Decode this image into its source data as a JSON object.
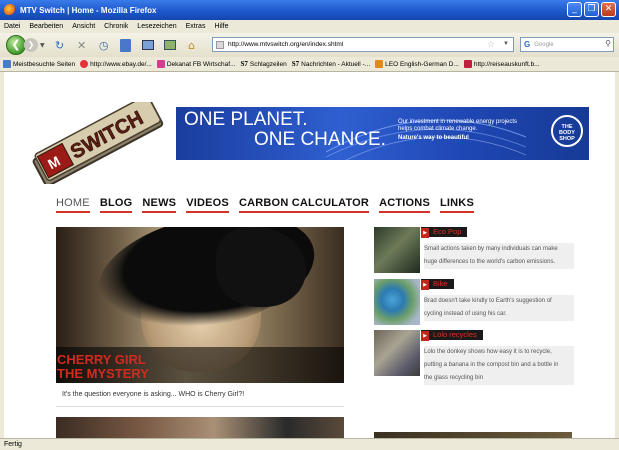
{
  "window": {
    "title": "MTV Switch | Home - Mozilla Firefox",
    "buttons": [
      "_",
      "❐",
      "✕"
    ]
  },
  "menu": [
    "Datei",
    "Bearbeiten",
    "Ansicht",
    "Chronik",
    "Lesezeichen",
    "Extras",
    "Hilfe"
  ],
  "navbar": {
    "url": "http://www.mtvswitch.org/en/index.shtml",
    "search_placeholder": "Google",
    "search_engine_letter": "G"
  },
  "bookmarks": [
    {
      "label": "Meistbesuchte Seiten",
      "icon": "folder-icon",
      "color": "#4a7ad0"
    },
    {
      "label": "http://www.ebay.de/...",
      "icon": "ebay-icon",
      "color": "#e53238"
    },
    {
      "label": "Dekanat FB Wirtschaf...",
      "icon": "page-icon",
      "color": "#d04090"
    },
    {
      "label": "Schlagzeilen",
      "icon": "spiegel-icon",
      "text": "S7"
    },
    {
      "label": "Nachrichten - Aktuell -...",
      "icon": "spiegel-icon",
      "text": "S7"
    },
    {
      "label": "LEO English-German D...",
      "icon": "leo-icon",
      "color": "#e08a1a"
    },
    {
      "label": "http://reiseauskunft.b...",
      "icon": "db-icon",
      "color": "#c02040"
    }
  ],
  "site": {
    "logo_text": "SWITCH",
    "banner": {
      "line1": "ONE PLANET.",
      "line2": "ONE CHANCE.",
      "small1": "Our investment in renewable energy projects",
      "small2": "helps combat climate change.",
      "small3": "Nature's way to beautiful",
      "brand": "THE BODY SHOP"
    },
    "nav": [
      "HOME",
      "BLOG",
      "NEWS",
      "VIDEOS",
      "CARBON CALCULATOR",
      "ACTIONS",
      "LINKS"
    ],
    "feature": {
      "caption_line1": "CHERRY GIRL",
      "caption_line2": "THE MYSTERY",
      "description": "It's the question everyone is asking... WHO is Cherry Girl?!"
    },
    "sidebar": [
      {
        "title": "Eco Pop",
        "desc1": "Small actions taken by many individuals can make",
        "desc2": "huge differences to the world's carbon emissions."
      },
      {
        "title": "Bike",
        "desc1": "Brad doesn't take kindly to Earth's suggestion of",
        "desc2": "cycling instead of using his car."
      },
      {
        "title": "Lolo recycles",
        "desc1": "Lolo the donkey shows how easy it is to recycle,",
        "desc2": "putting a banana in the compost bin and a bottle in",
        "desc3": "the glass recycling bin"
      }
    ]
  },
  "status": "Fertig"
}
